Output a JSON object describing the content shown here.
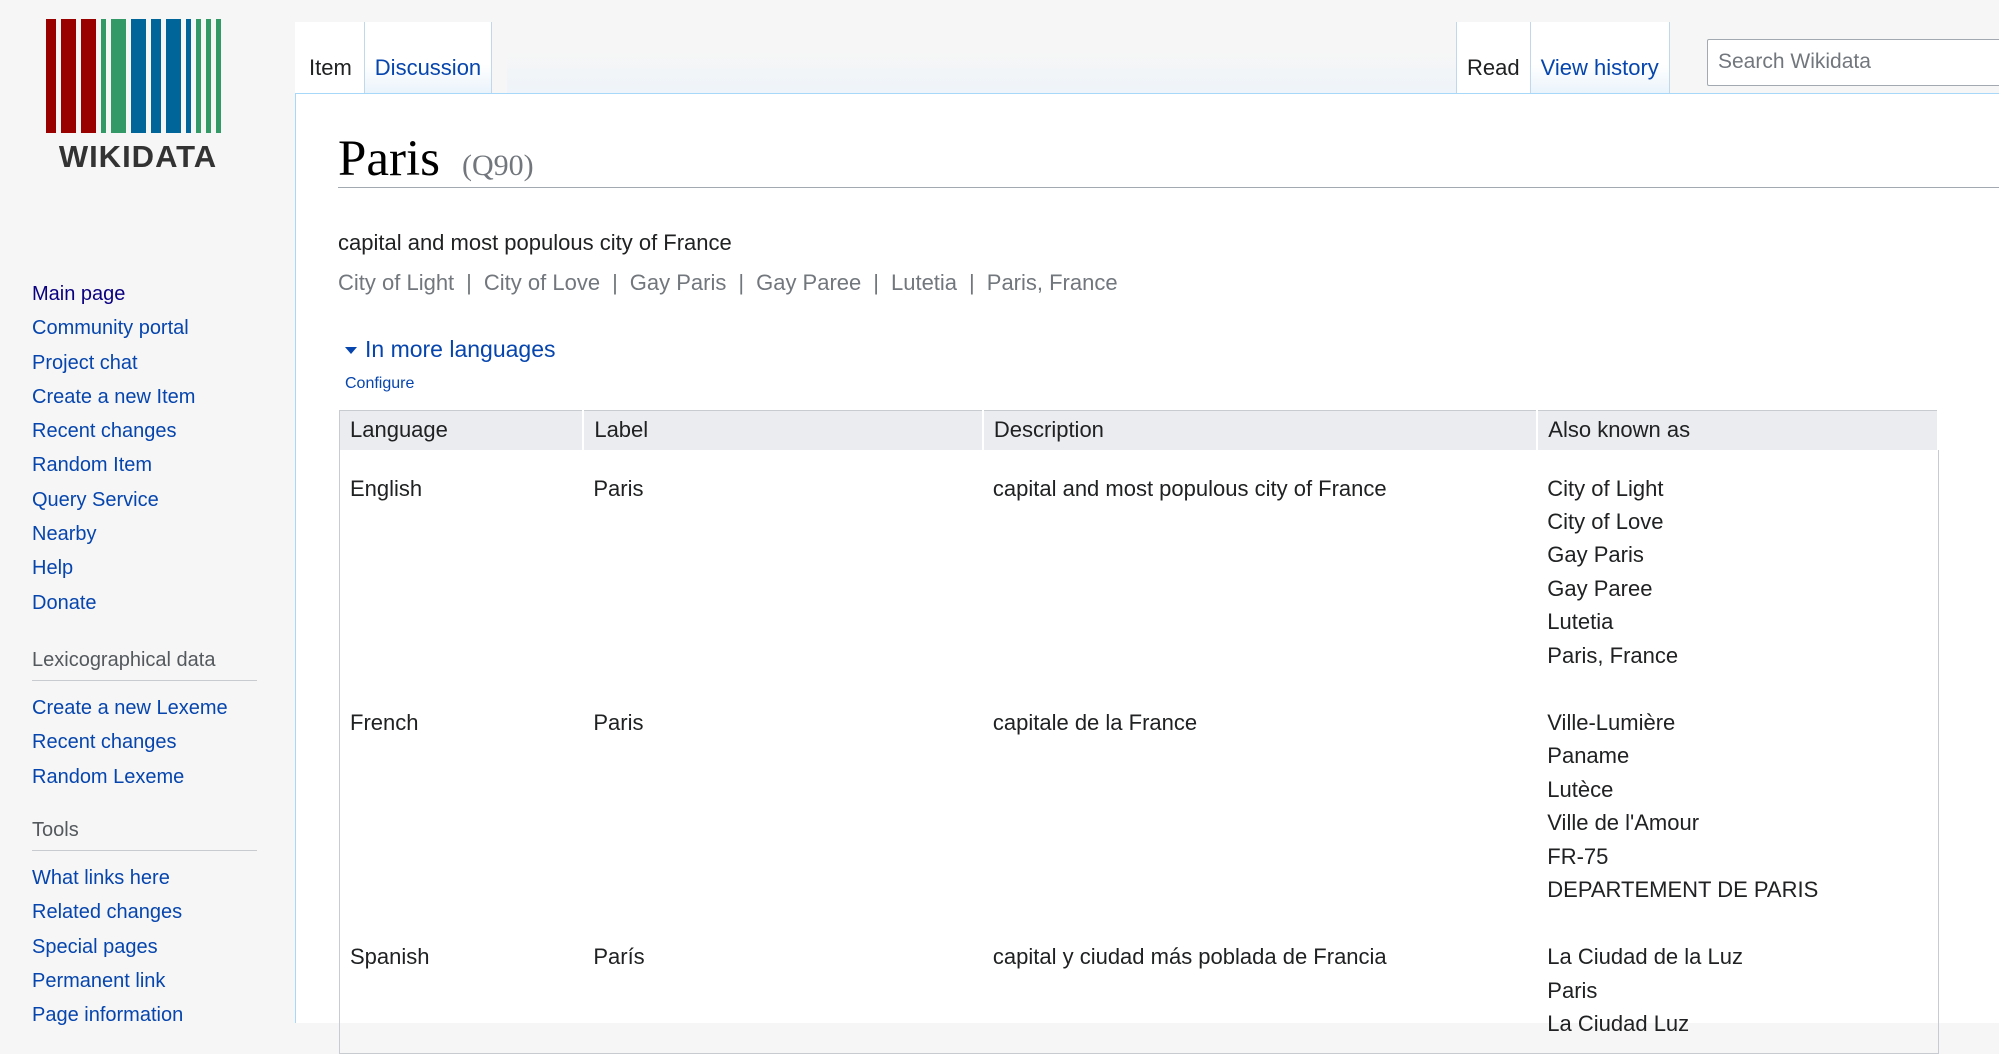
{
  "logo": {
    "wordmark": "WIKIDATA",
    "bar_colors": [
      "#990000",
      "#990000",
      "#990000",
      "#339966",
      "#339966",
      "#006699",
      "#006699",
      "#006699",
      "#339966"
    ]
  },
  "sidebar": {
    "main": [
      "Main page",
      "Community portal",
      "Project chat",
      "Create a new Item",
      "Recent changes",
      "Random Item",
      "Query Service",
      "Nearby",
      "Help",
      "Donate"
    ],
    "lexicographical": {
      "heading": "Lexicographical data",
      "items": [
        "Create a new Lexeme",
        "Recent changes",
        "Random Lexeme"
      ]
    },
    "tools": {
      "heading": "Tools",
      "items": [
        "What links here",
        "Related changes",
        "Special pages",
        "Permanent link",
        "Page information"
      ]
    }
  },
  "tabs": {
    "item": "Item",
    "discussion": "Discussion",
    "read": "Read",
    "view_history": "View history"
  },
  "search": {
    "placeholder": "Search Wikidata"
  },
  "item": {
    "label": "Paris",
    "qid": "(Q90)",
    "description": "capital and most populous city of France",
    "aliases": [
      "City of Light",
      "City of Love",
      "Gay Paris",
      "Gay Paree",
      "Lutetia",
      "Paris, France"
    ]
  },
  "languages_toggle": "In more languages",
  "configure": "Configure",
  "table": {
    "headers": [
      "Language",
      "Label",
      "Description",
      "Also known as"
    ],
    "rows": [
      {
        "language": "English",
        "label": "Paris",
        "description": "capital and most populous city of France",
        "aliases": [
          "City of Light",
          "City of Love",
          "Gay Paris",
          "Gay Paree",
          "Lutetia",
          "Paris, France"
        ]
      },
      {
        "language": "French",
        "label": "Paris",
        "description": "capitale de la France",
        "aliases": [
          "Ville-Lumière",
          "Paname",
          "Lutèce",
          "Ville de l'Amour",
          "FR-75",
          "DEPARTEMENT DE PARIS"
        ]
      },
      {
        "language": "Spanish",
        "label": "París",
        "description": "capital y ciudad más poblada de Francia",
        "aliases": [
          "La Ciudad de la Luz",
          "Paris",
          "La Ciudad Luz"
        ]
      }
    ]
  },
  "colors": {
    "link": "#0645ad",
    "visited_link": "#0b0080",
    "muted": "#72777d",
    "tab_border": "#a7d7f9"
  }
}
